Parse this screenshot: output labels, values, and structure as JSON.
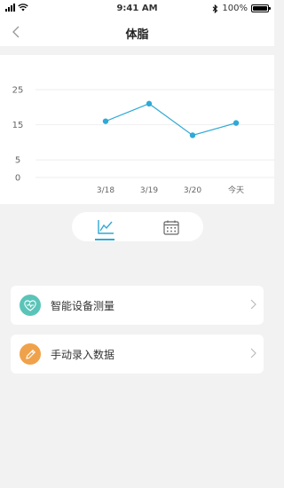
{
  "status": {
    "time": "9:41 AM",
    "battery": "100%"
  },
  "nav": {
    "title": "体脂"
  },
  "chart_data": {
    "type": "line",
    "categories": [
      "3/18",
      "3/19",
      "3/20",
      "今天"
    ],
    "values": [
      16,
      21,
      12,
      15.5
    ],
    "yticks": [
      0,
      5,
      15,
      25
    ],
    "ylim": [
      0,
      25
    ],
    "grid": true,
    "color": "#2fa9d6"
  },
  "view_toggle": {
    "active": "line-chart",
    "options": [
      "line-chart-icon",
      "calendar-icon"
    ],
    "accent": "#2fa9d6"
  },
  "actions": [
    {
      "label": "智能设备测量",
      "icon": "heart-pulse-icon",
      "color": "#5bc4b8"
    },
    {
      "label": "手动录入数据",
      "icon": "pencil-icon",
      "color": "#f0a24a"
    }
  ]
}
